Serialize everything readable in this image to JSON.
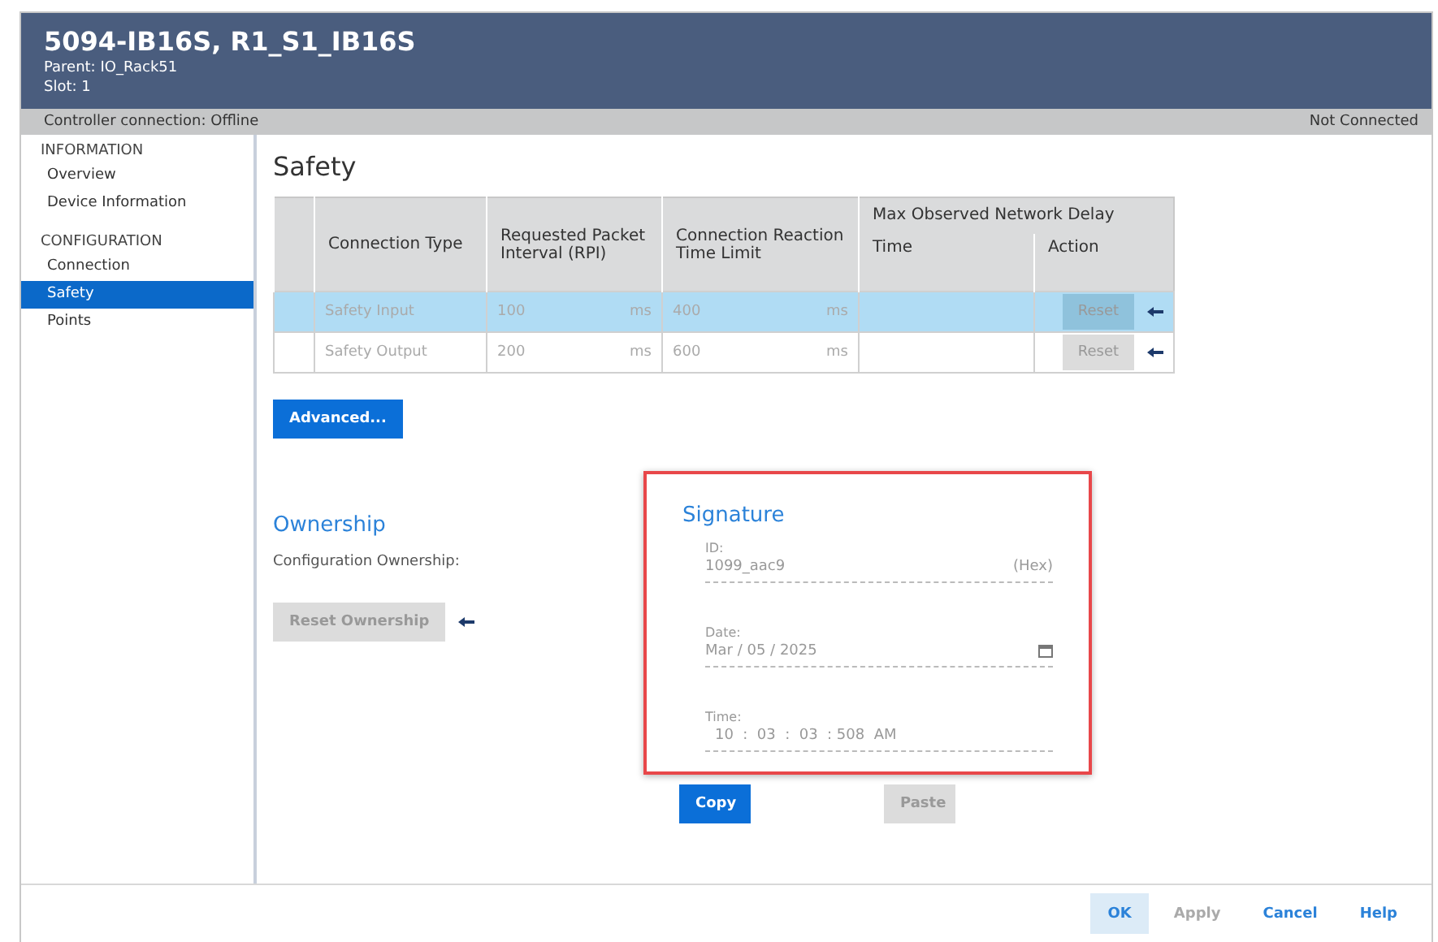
{
  "header": {
    "title": "5094-IB16S, R1_S1_IB16S",
    "parent": "Parent: IO_Rack51",
    "slot": "Slot: 1"
  },
  "status_bar": {
    "left": "Controller connection: Offline",
    "right": "Not Connected"
  },
  "sidebar": {
    "groups": [
      {
        "label": "INFORMATION",
        "items": [
          {
            "label": "Overview",
            "selected": false
          },
          {
            "label": "Device Information",
            "selected": false
          }
        ]
      },
      {
        "label": "CONFIGURATION",
        "items": [
          {
            "label": "Connection",
            "selected": false
          },
          {
            "label": "Safety",
            "selected": true
          },
          {
            "label": "Points",
            "selected": false
          }
        ]
      }
    ]
  },
  "page_title": "Safety",
  "table": {
    "group_header": "Max Observed Network Delay",
    "columns": [
      "Connection Type",
      "Requested Packet Interval (RPI)",
      "Connection Reaction Time Limit",
      "Time",
      "Action"
    ],
    "rows": [
      {
        "type": "Safety Input",
        "rpi": "100",
        "rpi_unit": "ms",
        "limit": "400",
        "limit_unit": "ms",
        "time": "",
        "action": "Reset",
        "selected": true
      },
      {
        "type": "Safety Output",
        "rpi": "200",
        "rpi_unit": "ms",
        "limit": "600",
        "limit_unit": "ms",
        "time": "",
        "action": "Reset",
        "selected": false
      }
    ]
  },
  "advanced_button": {
    "label": "Advanced...",
    "disabled": false
  },
  "ownership": {
    "title": "Ownership",
    "label": "Configuration Ownership:",
    "button": {
      "label": "Reset Ownership",
      "disabled": true
    }
  },
  "signature": {
    "title": "Signature",
    "id_label": "ID:",
    "id_value": "1099_aac9",
    "id_suffix": "(Hex)",
    "date_label": "Date:",
    "date_value": "Mar / 05 / 2025",
    "time_label": "Time:",
    "time_value": "10  :  03  :  03  : 508  AM"
  },
  "signature_buttons": [
    {
      "label": "Copy",
      "disabled": false
    },
    {
      "label": "Paste",
      "disabled": true
    }
  ],
  "footer_buttons": [
    {
      "label": "OK",
      "kind": "primary",
      "disabled": false
    },
    {
      "label": "Apply",
      "kind": "link",
      "disabled": true
    },
    {
      "label": "Cancel",
      "kind": "link",
      "disabled": false
    },
    {
      "label": "Help",
      "kind": "link",
      "disabled": false
    }
  ]
}
